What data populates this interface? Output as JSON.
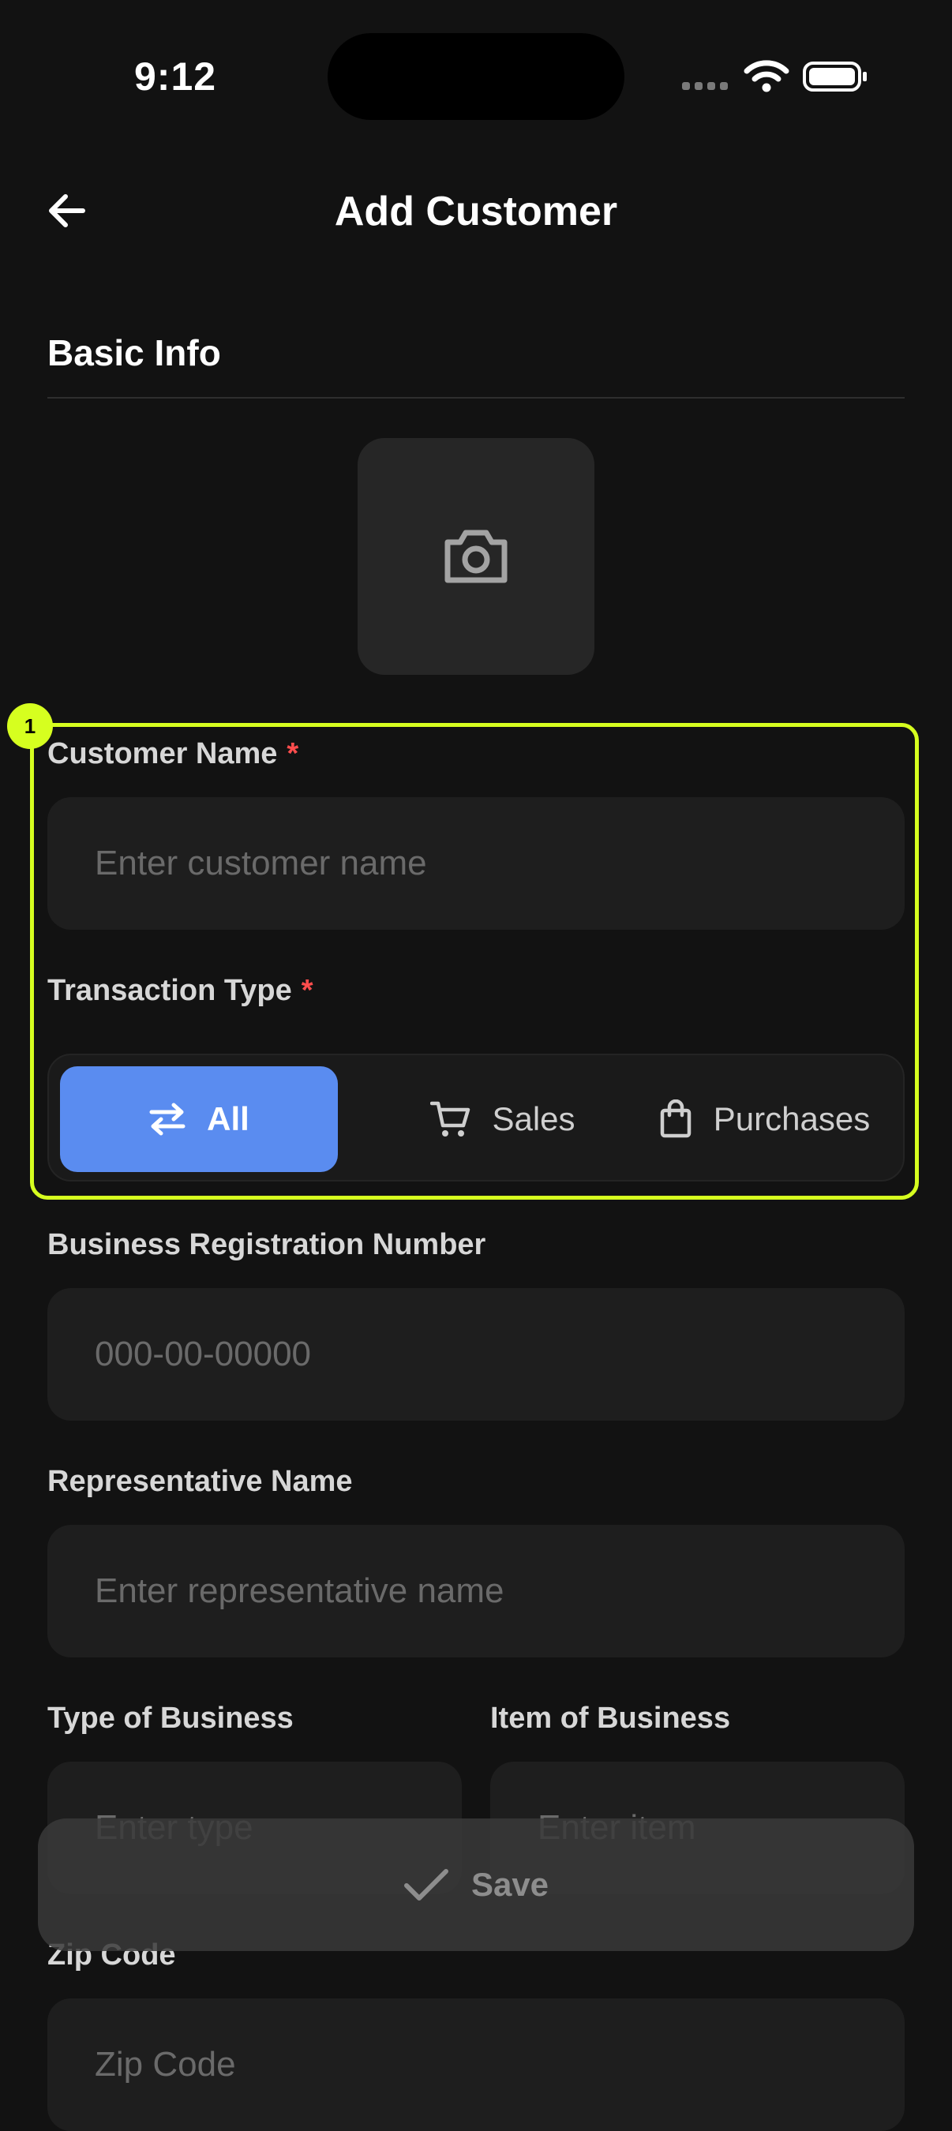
{
  "status_bar": {
    "time": "9:12"
  },
  "header": {
    "title": "Add Customer"
  },
  "section": {
    "basic_info": "Basic Info"
  },
  "form": {
    "customer_name": {
      "label": "Customer Name",
      "required_mark": "*",
      "placeholder": "Enter customer name",
      "value": ""
    },
    "transaction_type": {
      "label": "Transaction Type",
      "required_mark": "*",
      "options": [
        {
          "label": "All",
          "icon": "swap-arrows-icon",
          "selected": true
        },
        {
          "label": "Sales",
          "icon": "cart-icon",
          "selected": false
        },
        {
          "label": "Purchases",
          "icon": "shopping-bag-icon",
          "selected": false
        }
      ]
    },
    "business_registration": {
      "label": "Business Registration Number",
      "placeholder": "000-00-00000",
      "value": ""
    },
    "representative_name": {
      "label": "Representative Name",
      "placeholder": "Enter representative name",
      "value": ""
    },
    "type_of_business": {
      "label": "Type of Business",
      "placeholder": "Enter type",
      "value": ""
    },
    "item_of_business": {
      "label": "Item of Business",
      "placeholder": "Enter item",
      "value": ""
    },
    "zip_code": {
      "label": "Zip Code",
      "placeholder": "Zip Code",
      "value": ""
    }
  },
  "save_button": {
    "label": "Save"
  },
  "highlight": {
    "badge": "1"
  },
  "colors": {
    "accent": "#5a8cf0",
    "highlight": "#d6ff1f",
    "required": "#ff4d4d",
    "background": "#121212"
  }
}
